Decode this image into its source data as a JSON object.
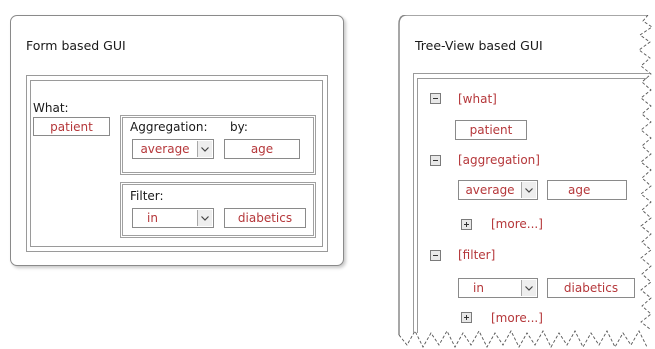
{
  "form_gui": {
    "title": "Form based GUI",
    "what_label": "What:",
    "what_value": "patient",
    "aggregation_label": "Aggregation:",
    "by_label": "by:",
    "aggregation_value": "average",
    "by_value": "age",
    "filter_label": "Filter:",
    "filter_value": "in",
    "filter_target": "diabetics"
  },
  "tree_gui": {
    "title": "Tree-View based GUI",
    "what_node": "[what]",
    "what_value": "patient",
    "aggregation_node": "[aggregation]",
    "aggregation_value": "average",
    "aggregation_by": "age",
    "more_1": "[more...]",
    "filter_node": "[filter]",
    "filter_value": "in",
    "filter_target": "diabetics",
    "more_2": "[more...]"
  },
  "colors": {
    "value_text": "#b5373a",
    "border": "#8a8a8a"
  }
}
